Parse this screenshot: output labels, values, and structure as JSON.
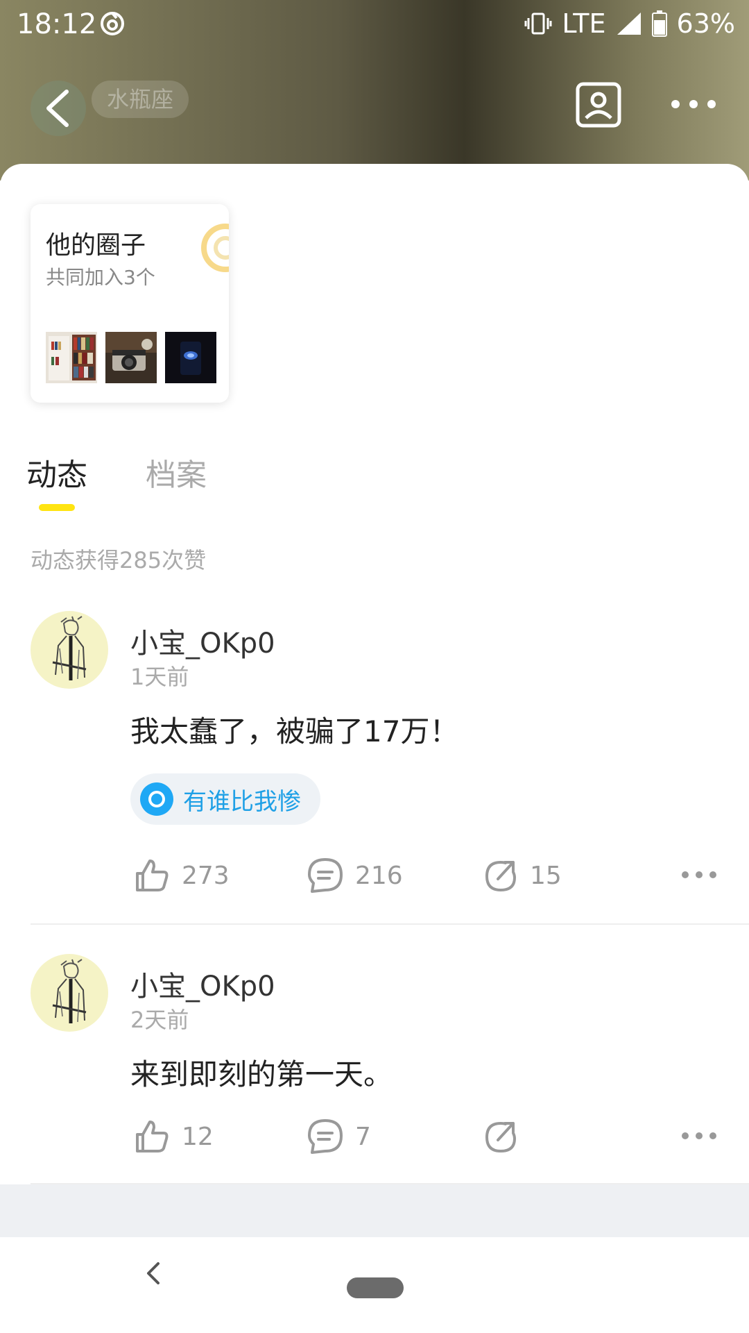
{
  "status": {
    "time": "18:12",
    "network": "LTE",
    "battery": "63%"
  },
  "header": {
    "tag": "水瓶座"
  },
  "circles": {
    "title": "他的圈子",
    "subtitle": "共同加入3个"
  },
  "tabs": [
    {
      "label": "动态",
      "active": true
    },
    {
      "label": "档案",
      "active": false
    }
  ],
  "likes_summary": "动态获得285次赞",
  "posts": [
    {
      "author": "小宝_OKp0",
      "time": "1天前",
      "content": "我太蠢了，被骗了17万！",
      "topic": "有谁比我惨",
      "likes": "273",
      "comments": "216",
      "shares": "15"
    },
    {
      "author": "小宝_OKp0",
      "time": "2天前",
      "content": "来到即刻的第一天。",
      "likes": "12",
      "comments": "7",
      "shares": ""
    }
  ],
  "colors": {
    "accent_yellow": "#ffe411",
    "topic_blue": "#1fa8f5"
  }
}
